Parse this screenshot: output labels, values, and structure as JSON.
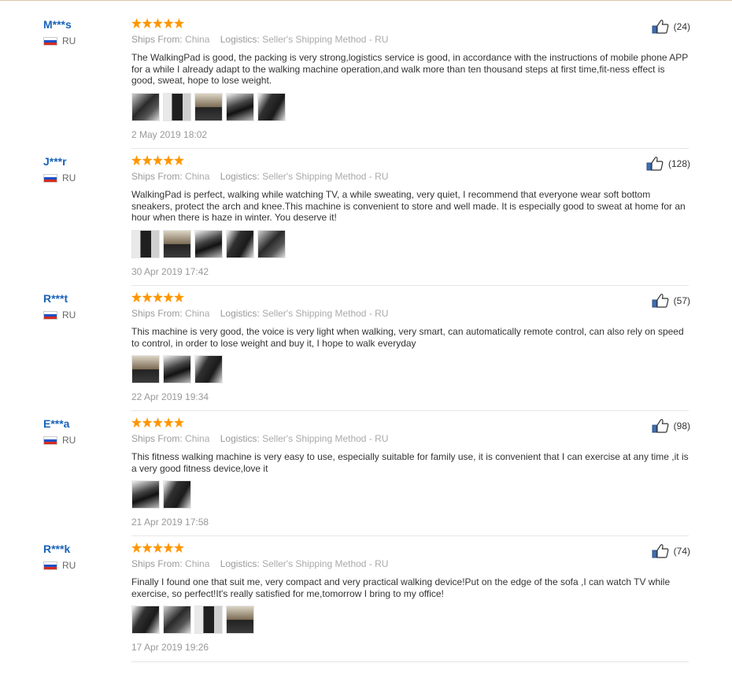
{
  "reviews": [
    {
      "user": "M***s",
      "country": "RU",
      "likes": "(24)",
      "ship_from_label": "Ships From:",
      "ship_from": "China",
      "logistics_label": "Logistics:",
      "logistics": "Seller's Shipping Method - RU",
      "text": "The WalkingPad is good, the packing is very strong,logistics service is good, in accordance with the instructions of mobile phone APP for a while I already adapt to the walking machine operation,and walk more than ten thousand steps at first time,fit-ness effect is good, sweat,  hope to lose weight.",
      "date": "2 May 2019 18:02",
      "thumbs": 5
    },
    {
      "user": "J***r",
      "country": "RU",
      "likes": "(128)",
      "ship_from_label": "Ships From:",
      "ship_from": "China",
      "logistics_label": "Logistics:",
      "logistics": "Seller's Shipping Method - RU",
      "text": "WalkingPad is perfect, walking while watching TV, a while sweating, very quiet, I recommend that everyone wear soft bottom sneakers, protect the arch and knee.This machine is convenient to store and well made. It is especially good to sweat at home for an hour when there is haze in winter. You deserve it!",
      "date": "30 Apr 2019 17:42",
      "thumbs": 5
    },
    {
      "user": "R***t",
      "country": "RU",
      "likes": "(57)",
      "ship_from_label": "Ships From:",
      "ship_from": "China",
      "logistics_label": "Logistics:",
      "logistics": "Seller's Shipping Method - RU",
      "text": "This machine is very good, the voice is very light when walking, very smart, can automatically remote control, can also rely on speed to control, in order to lose weight and buy it, I hope to walk everyday",
      "date": "22 Apr 2019 19:34",
      "thumbs": 3
    },
    {
      "user": "E***a",
      "country": "RU",
      "likes": "(98)",
      "ship_from_label": "Ships From:",
      "ship_from": "China",
      "logistics_label": "Logistics:",
      "logistics": "Seller's Shipping Method - RU",
      "text": "This fitness walking machine is very easy to use, especially suitable for family use, it is convenient that I can exercise at any time ,it is a very good fitness device,love it",
      "date": "21 Apr 2019 17:58",
      "thumbs": 2
    },
    {
      "user": "R***k",
      "country": "RU",
      "likes": "(74)",
      "ship_from_label": "Ships From:",
      "ship_from": "China",
      "logistics_label": "Logistics:",
      "logistics": "Seller's Shipping Method - RU",
      "text": "Finally I found one that suit me, very compact and very practical walking device!Put on the edge of the sofa ,I can watch TV while exercise, so perfect!It's really satisfied for me,tomorrow I bring to my office!",
      "date": "17 Apr 2019 19:26",
      "thumbs": 4
    }
  ],
  "rating_stars": 5,
  "colors": {
    "username": "#1a63b8",
    "star": "#ff9600",
    "muted": "#999999"
  },
  "icons": {
    "like": "thumbs-up-icon",
    "flag": "russia-flag-icon"
  }
}
